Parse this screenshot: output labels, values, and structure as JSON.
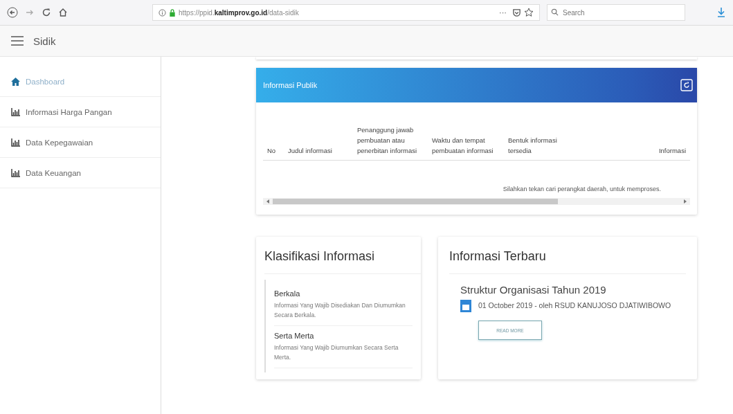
{
  "browser": {
    "url": "https://ppid.**kaltimprov.go.id**/data-sidik",
    "more": "···",
    "search": {
      "placeholder": "Search"
    }
  },
  "app_bar": {
    "title": "Sidik"
  },
  "sidebar": {
    "items": [
      {
        "label": "Dashboard",
        "kind": "home",
        "selected": true
      },
      {
        "label": "Informasi Harga Pangan",
        "kind": "chart",
        "selected": false
      },
      {
        "label": "Data Kepegawaian",
        "kind": "chart",
        "selected": false
      },
      {
        "label": "Data Keuangan",
        "kind": "chart",
        "selected": false
      }
    ]
  },
  "public_info": {
    "title": "Informasi Publik",
    "table": {
      "columns": [
        "No",
        "Judul informasi",
        "Penanggung jawab pembuatan atau penerbitan informasi",
        "Waktu dan tempat pembuatan informasi",
        "Bentuk informasi tersedia",
        "Informasi"
      ],
      "empty_message": "Silahkan tekan cari perangkat daerah, untuk memproses."
    }
  },
  "classification": {
    "title": "Klasifikasi Informasi",
    "items": [
      {
        "name": "Berkala",
        "description": "Informasi Yang Wajib Disediakan Dan Diumumkan Secara Berkala."
      },
      {
        "name": "Serta Merta",
        "description": "Informasi Yang Wajib Diumumkan Secara Serta Merta."
      }
    ]
  },
  "latest": {
    "title": "Informasi Terbaru",
    "items": [
      {
        "title": "Struktur Organisasi Tahun 2019",
        "meta": "01 October 2019 - oleh RSUD KANUJOSO DJATIWIBOWO",
        "button": "READ MORE"
      }
    ]
  }
}
